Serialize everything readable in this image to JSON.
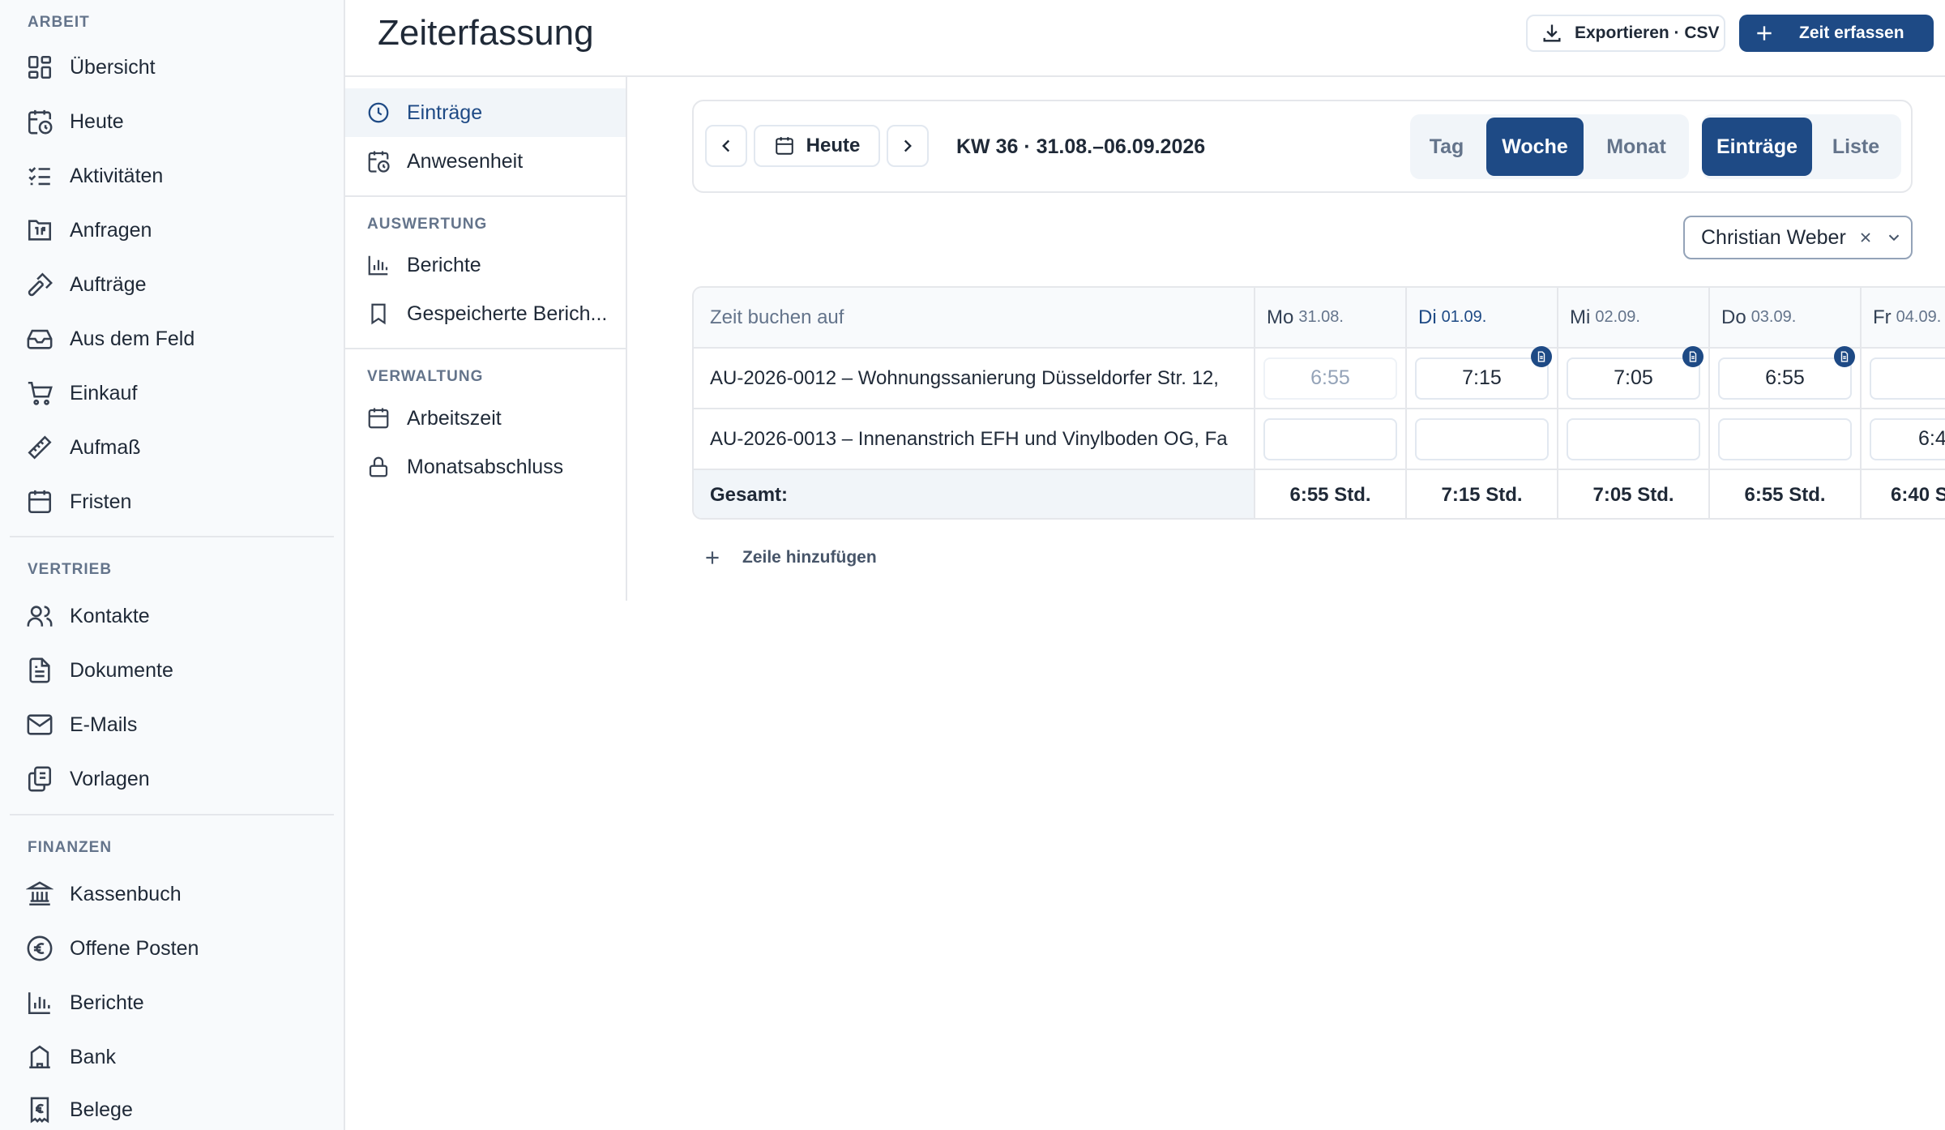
{
  "sidebar": {
    "groups": [
      {
        "title": "ARBEIT",
        "items": [
          {
            "label": "Übersicht",
            "icon": "dashboard-icon"
          },
          {
            "label": "Heute",
            "icon": "calendar-clock-icon"
          },
          {
            "label": "Aktivitäten",
            "icon": "checklist-icon"
          },
          {
            "label": "Anfragen",
            "icon": "inbox-request-icon"
          },
          {
            "label": "Aufträge",
            "icon": "hammer-icon"
          },
          {
            "label": "Aus dem Feld",
            "icon": "tray-icon"
          },
          {
            "label": "Einkauf",
            "icon": "cart-icon"
          },
          {
            "label": "Aufmaß",
            "icon": "ruler-icon"
          },
          {
            "label": "Fristen",
            "icon": "calendar-icon"
          }
        ]
      },
      {
        "title": "VERTRIEB",
        "items": [
          {
            "label": "Kontakte",
            "icon": "users-icon"
          },
          {
            "label": "Dokumente",
            "icon": "document-icon"
          },
          {
            "label": "E-Mails",
            "icon": "mail-icon"
          },
          {
            "label": "Vorlagen",
            "icon": "copy-icon"
          }
        ]
      },
      {
        "title": "FINANZEN",
        "items": [
          {
            "label": "Kassenbuch",
            "icon": "bank-icon"
          },
          {
            "label": "Offene Posten",
            "icon": "euro-circle-icon"
          },
          {
            "label": "Berichte",
            "icon": "bar-chart-icon"
          },
          {
            "label": "Bank",
            "icon": "building-icon"
          },
          {
            "label": "Belege",
            "icon": "receipt-euro-icon"
          }
        ]
      }
    ]
  },
  "header": {
    "title": "Zeiterfassung",
    "export_label": "Exportieren · CSV",
    "new_label": "Zeit erfassen"
  },
  "subnav": {
    "items_top": [
      {
        "label": "Einträge",
        "icon": "clock-icon",
        "active": true
      },
      {
        "label": "Anwesenheit",
        "icon": "calendar-clock-icon",
        "active": false
      }
    ],
    "groups": [
      {
        "title": "AUSWERTUNG",
        "items": [
          {
            "label": "Berichte",
            "icon": "bar-chart-icon"
          },
          {
            "label": "Gespeicherte Berich...",
            "icon": "bookmark-icon"
          }
        ]
      },
      {
        "title": "VERWALTUNG",
        "items": [
          {
            "label": "Arbeitszeit",
            "icon": "calendar-icon"
          },
          {
            "label": "Monatsabschluss",
            "icon": "lock-icon"
          }
        ]
      }
    ]
  },
  "toolbar": {
    "today_label": "Heute",
    "week_label": "KW 36 · 31.08.–06.09.2026",
    "range_options": [
      "Tag",
      "Woche",
      "Monat"
    ],
    "range_selected": "Woche",
    "view_options": [
      "Einträge",
      "Liste"
    ],
    "view_selected": "Einträge"
  },
  "filter": {
    "employee": "Christian Weber"
  },
  "timesheet": {
    "first_col_header": "Zeit buchen auf",
    "days": [
      {
        "weekday": "Mo",
        "date": "31.08.",
        "today": false
      },
      {
        "weekday": "Di",
        "date": "01.09.",
        "today": true
      },
      {
        "weekday": "Mi",
        "date": "02.09.",
        "today": false
      },
      {
        "weekday": "Do",
        "date": "03.09.",
        "today": false
      },
      {
        "weekday": "Fr",
        "date": "04.09.",
        "today": false
      }
    ],
    "rows": [
      {
        "job": "AU-2026-0012 – Wohnungssanierung Düsseldorfer Str. 12,",
        "times": [
          "6:55",
          "7:15",
          "7:05",
          "6:55",
          ""
        ],
        "muted": [
          true,
          false,
          false,
          false,
          false
        ],
        "notes": [
          false,
          true,
          true,
          true,
          false
        ]
      },
      {
        "job": "AU-2026-0013 – Innenanstrich EFH und Vinylboden OG, Fa",
        "times": [
          "",
          "",
          "",
          "",
          "6:4"
        ],
        "muted": [
          false,
          false,
          false,
          false,
          false
        ],
        "notes": [
          false,
          false,
          false,
          false,
          false
        ]
      }
    ],
    "total_label": "Gesamt:",
    "totals": [
      "6:55 Std.",
      "7:15 Std.",
      "7:05 Std.",
      "6:55 Std.",
      "6:40 S"
    ]
  },
  "add_row_label": "Zeile hinzufügen",
  "colors": {
    "accent": "#1e4a85",
    "border": "#e5e7eb",
    "muted_text": "#64748b"
  }
}
